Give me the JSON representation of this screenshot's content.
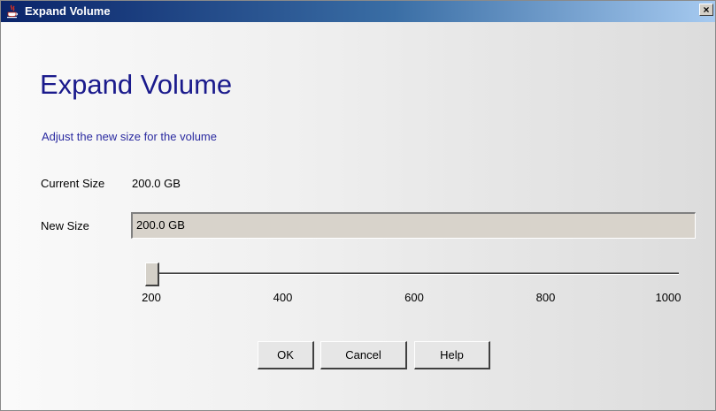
{
  "window": {
    "title": "Expand Volume",
    "close_glyph": "×",
    "title_icon": "java-cup-icon"
  },
  "dialog": {
    "heading": "Expand Volume",
    "subtitle": "Adjust the new size for the volume",
    "current_size_label": "Current Size",
    "current_size_value": "200.0 GB",
    "new_size_label": "New Size",
    "new_size_value": "200.0 GB"
  },
  "slider": {
    "min": 200,
    "max": 1000,
    "value": 200,
    "ticks": [
      "200",
      "400",
      "600",
      "800",
      "1000"
    ]
  },
  "buttons": {
    "ok": "OK",
    "cancel": "Cancel",
    "help": "Help"
  },
  "colors": {
    "titlebar_start": "#0a246a",
    "heading": "#1a1a8c"
  }
}
